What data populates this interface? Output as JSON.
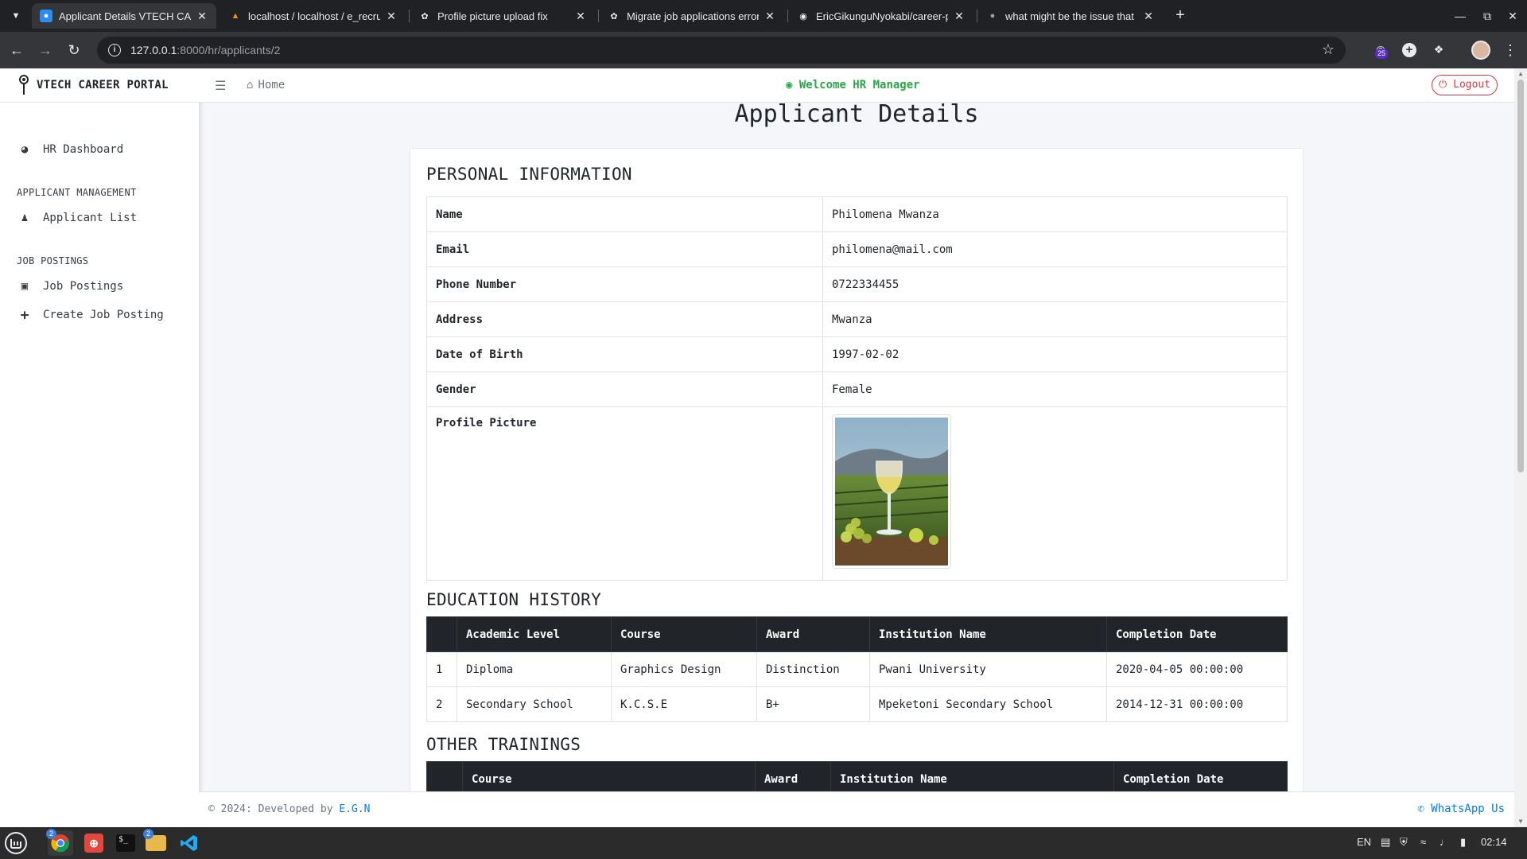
{
  "browser": {
    "tabs": [
      {
        "title": "Applicant Details VTECH CAREER PORTAL",
        "active": true,
        "icon": "site-favicon"
      },
      {
        "title": "localhost / localhost / e_recruitment",
        "active": false,
        "icon": "phpmyadmin-favicon"
      },
      {
        "title": "Profile picture upload fix",
        "active": false,
        "icon": "chatgpt-favicon"
      },
      {
        "title": "Migrate job applications error",
        "active": false,
        "icon": "chatgpt-favicon"
      },
      {
        "title": "EricGikunguNyokabi/career-portal",
        "active": false,
        "icon": "github-favicon"
      },
      {
        "title": "what might be the issue that",
        "active": false,
        "icon": "search-favicon"
      }
    ],
    "url_host": "127.0.0.1",
    "url_path": ":8000/hr/applicants/2",
    "extension_badge": "25"
  },
  "sidebar": {
    "brand": "VTECH CAREER PORTAL",
    "dashboard": "HR Dashboard",
    "applicant_heading": "APPLICANT MANAGEMENT",
    "applicant_list": "Applicant List",
    "jobs_heading": "JOB POSTINGS",
    "job_postings": "Job Postings",
    "create_job": "Create Job Posting"
  },
  "topnav": {
    "home": "Home",
    "welcome": "Welcome HR Manager",
    "logout": "Logout"
  },
  "page_title": "Applicant Details",
  "personal": {
    "heading": "PERSONAL INFORMATION",
    "rows": [
      {
        "label": "Name",
        "value": "Philomena Mwanza"
      },
      {
        "label": "Email",
        "value": "philomena@mail.com"
      },
      {
        "label": "Phone Number",
        "value": "0722334455"
      },
      {
        "label": "Address",
        "value": "Mwanza"
      },
      {
        "label": "Date of Birth",
        "value": "1997-02-02"
      },
      {
        "label": "Gender",
        "value": "Female"
      },
      {
        "label": "Profile Picture",
        "value": ""
      }
    ]
  },
  "education": {
    "heading": "EDUCATION HISTORY",
    "columns": [
      "",
      "Academic Level",
      "Course",
      "Award",
      "Institution Name",
      "Completion Date"
    ],
    "rows": [
      [
        "1",
        "Diploma",
        "Graphics Design",
        "Distinction",
        "Pwani University",
        "2020-04-05 00:00:00"
      ],
      [
        "2",
        "Secondary School",
        "K.C.S.E",
        "B+",
        "Mpeketoni Secondary School",
        "2014-12-31 00:00:00"
      ]
    ]
  },
  "trainings": {
    "heading": "OTHER TRAININGS",
    "columns": [
      "",
      "Course",
      "Award",
      "Institution Name",
      "Completion Date"
    ]
  },
  "footer": {
    "copyright": "© 2024: Developed by ",
    "developer": "E.G.N",
    "whatsapp": "WhatsApp Us"
  },
  "taskbar": {
    "chrome_count": "2",
    "files_count": "2",
    "lang": "EN",
    "time": "02:14"
  },
  "colors": {
    "success": "#28a745",
    "danger": "#dc3545",
    "link": "#007bff",
    "table_head": "#212529"
  }
}
